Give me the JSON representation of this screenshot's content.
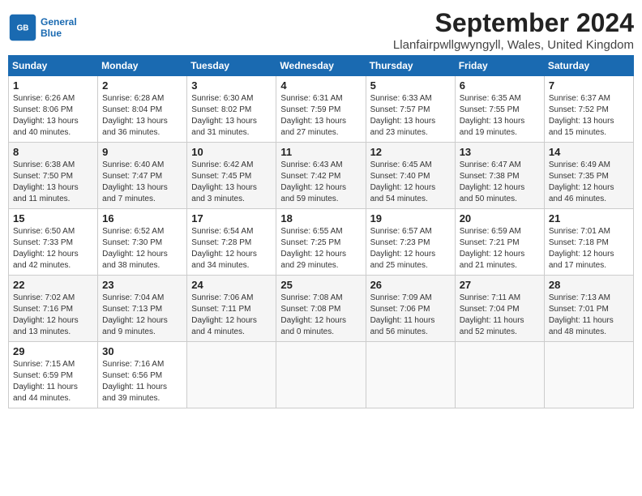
{
  "logo": {
    "line1": "General",
    "line2": "Blue"
  },
  "title": "September 2024",
  "location": "Llanfairpwllgwyngyll, Wales, United Kingdom",
  "days_of_week": [
    "Sunday",
    "Monday",
    "Tuesday",
    "Wednesday",
    "Thursday",
    "Friday",
    "Saturday"
  ],
  "weeks": [
    [
      {
        "day": 1,
        "info": "Sunrise: 6:26 AM\nSunset: 8:06 PM\nDaylight: 13 hours\nand 40 minutes."
      },
      {
        "day": 2,
        "info": "Sunrise: 6:28 AM\nSunset: 8:04 PM\nDaylight: 13 hours\nand 36 minutes."
      },
      {
        "day": 3,
        "info": "Sunrise: 6:30 AM\nSunset: 8:02 PM\nDaylight: 13 hours\nand 31 minutes."
      },
      {
        "day": 4,
        "info": "Sunrise: 6:31 AM\nSunset: 7:59 PM\nDaylight: 13 hours\nand 27 minutes."
      },
      {
        "day": 5,
        "info": "Sunrise: 6:33 AM\nSunset: 7:57 PM\nDaylight: 13 hours\nand 23 minutes."
      },
      {
        "day": 6,
        "info": "Sunrise: 6:35 AM\nSunset: 7:55 PM\nDaylight: 13 hours\nand 19 minutes."
      },
      {
        "day": 7,
        "info": "Sunrise: 6:37 AM\nSunset: 7:52 PM\nDaylight: 13 hours\nand 15 minutes."
      }
    ],
    [
      {
        "day": 8,
        "info": "Sunrise: 6:38 AM\nSunset: 7:50 PM\nDaylight: 13 hours\nand 11 minutes."
      },
      {
        "day": 9,
        "info": "Sunrise: 6:40 AM\nSunset: 7:47 PM\nDaylight: 13 hours\nand 7 minutes."
      },
      {
        "day": 10,
        "info": "Sunrise: 6:42 AM\nSunset: 7:45 PM\nDaylight: 13 hours\nand 3 minutes."
      },
      {
        "day": 11,
        "info": "Sunrise: 6:43 AM\nSunset: 7:42 PM\nDaylight: 12 hours\nand 59 minutes."
      },
      {
        "day": 12,
        "info": "Sunrise: 6:45 AM\nSunset: 7:40 PM\nDaylight: 12 hours\nand 54 minutes."
      },
      {
        "day": 13,
        "info": "Sunrise: 6:47 AM\nSunset: 7:38 PM\nDaylight: 12 hours\nand 50 minutes."
      },
      {
        "day": 14,
        "info": "Sunrise: 6:49 AM\nSunset: 7:35 PM\nDaylight: 12 hours\nand 46 minutes."
      }
    ],
    [
      {
        "day": 15,
        "info": "Sunrise: 6:50 AM\nSunset: 7:33 PM\nDaylight: 12 hours\nand 42 minutes."
      },
      {
        "day": 16,
        "info": "Sunrise: 6:52 AM\nSunset: 7:30 PM\nDaylight: 12 hours\nand 38 minutes."
      },
      {
        "day": 17,
        "info": "Sunrise: 6:54 AM\nSunset: 7:28 PM\nDaylight: 12 hours\nand 34 minutes."
      },
      {
        "day": 18,
        "info": "Sunrise: 6:55 AM\nSunset: 7:25 PM\nDaylight: 12 hours\nand 29 minutes."
      },
      {
        "day": 19,
        "info": "Sunrise: 6:57 AM\nSunset: 7:23 PM\nDaylight: 12 hours\nand 25 minutes."
      },
      {
        "day": 20,
        "info": "Sunrise: 6:59 AM\nSunset: 7:21 PM\nDaylight: 12 hours\nand 21 minutes."
      },
      {
        "day": 21,
        "info": "Sunrise: 7:01 AM\nSunset: 7:18 PM\nDaylight: 12 hours\nand 17 minutes."
      }
    ],
    [
      {
        "day": 22,
        "info": "Sunrise: 7:02 AM\nSunset: 7:16 PM\nDaylight: 12 hours\nand 13 minutes."
      },
      {
        "day": 23,
        "info": "Sunrise: 7:04 AM\nSunset: 7:13 PM\nDaylight: 12 hours\nand 9 minutes."
      },
      {
        "day": 24,
        "info": "Sunrise: 7:06 AM\nSunset: 7:11 PM\nDaylight: 12 hours\nand 4 minutes."
      },
      {
        "day": 25,
        "info": "Sunrise: 7:08 AM\nSunset: 7:08 PM\nDaylight: 12 hours\nand 0 minutes."
      },
      {
        "day": 26,
        "info": "Sunrise: 7:09 AM\nSunset: 7:06 PM\nDaylight: 11 hours\nand 56 minutes."
      },
      {
        "day": 27,
        "info": "Sunrise: 7:11 AM\nSunset: 7:04 PM\nDaylight: 11 hours\nand 52 minutes."
      },
      {
        "day": 28,
        "info": "Sunrise: 7:13 AM\nSunset: 7:01 PM\nDaylight: 11 hours\nand 48 minutes."
      }
    ],
    [
      {
        "day": 29,
        "info": "Sunrise: 7:15 AM\nSunset: 6:59 PM\nDaylight: 11 hours\nand 44 minutes."
      },
      {
        "day": 30,
        "info": "Sunrise: 7:16 AM\nSunset: 6:56 PM\nDaylight: 11 hours\nand 39 minutes."
      },
      null,
      null,
      null,
      null,
      null
    ]
  ]
}
